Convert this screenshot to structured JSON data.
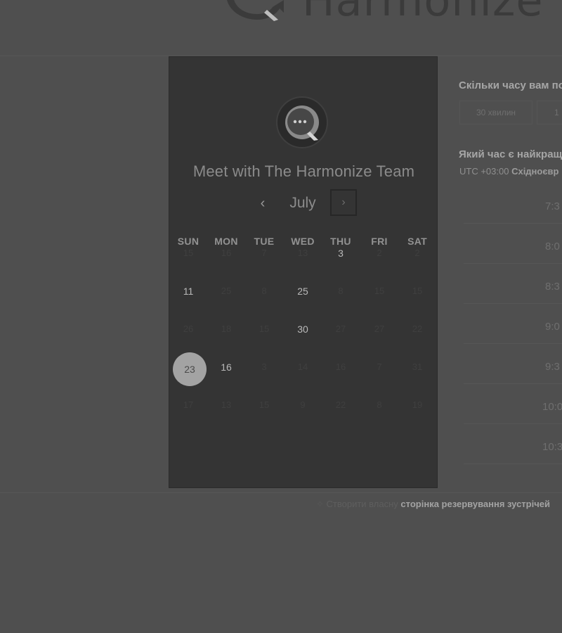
{
  "brand": {
    "name": "Harmonize"
  },
  "calendar": {
    "title": "Meet with The Harmonize Team",
    "month": "July",
    "prev_label": "‹",
    "next_label": "›",
    "weekdays": [
      "SUN",
      "MON",
      "TUE",
      "WED",
      "THU",
      "FRI",
      "SAT"
    ],
    "rows": [
      [
        {
          "d": "15",
          "s": "off"
        },
        {
          "d": "16",
          "s": "off"
        },
        {
          "d": "7",
          "s": "off"
        },
        {
          "d": "13",
          "s": "off"
        },
        {
          "d": "3",
          "s": "on"
        },
        {
          "d": "2",
          "s": "off"
        },
        {
          "d": "2",
          "s": "off"
        }
      ],
      [
        {
          "d": "11",
          "s": "on"
        },
        {
          "d": "25",
          "s": "off"
        },
        {
          "d": "8",
          "s": "off"
        },
        {
          "d": "25",
          "s": "on"
        },
        {
          "d": "8",
          "s": "off"
        },
        {
          "d": "15",
          "s": "off"
        },
        {
          "d": "15",
          "s": "off"
        }
      ],
      [
        {
          "d": "26",
          "s": "off"
        },
        {
          "d": "18",
          "s": "off"
        },
        {
          "d": "15",
          "s": "off"
        },
        {
          "d": "30",
          "s": "on"
        },
        {
          "d": "27",
          "s": "off"
        },
        {
          "d": "27",
          "s": "off"
        },
        {
          "d": "22",
          "s": "off"
        }
      ],
      [
        {
          "d": "23",
          "s": "selected"
        },
        {
          "d": "16",
          "s": "on"
        },
        {
          "d": "3",
          "s": "off"
        },
        {
          "d": "14",
          "s": "off"
        },
        {
          "d": "16",
          "s": "off"
        },
        {
          "d": "7",
          "s": "off"
        },
        {
          "d": "31",
          "s": "off"
        }
      ],
      [
        {
          "d": "17",
          "s": "off"
        },
        {
          "d": "13",
          "s": "off"
        },
        {
          "d": "15",
          "s": "off"
        },
        {
          "d": "9",
          "s": "off"
        },
        {
          "d": "22",
          "s": "off"
        },
        {
          "d": "8",
          "s": "off"
        },
        {
          "d": "19",
          "s": "off"
        }
      ]
    ]
  },
  "scheduler": {
    "duration_question": "Скільки часу вам по",
    "durations": [
      "30 хвилин",
      "1"
    ],
    "time_question": "Який час є найкращ",
    "timezone_offset": "UTC +03:00",
    "timezone_name": "Східноєвр",
    "slots": [
      "7:3",
      "8:0",
      "8:3",
      "9:0",
      "9:3",
      "10:0",
      "10:3"
    ]
  },
  "footer": {
    "icon": "sparkle-icon",
    "prefix": "Створити власну",
    "link": "сторінка резервування зустрічей"
  },
  "colors": {
    "background": "#4f4f4f",
    "panel": "#343434",
    "selected_day": "#a3a3a3"
  }
}
